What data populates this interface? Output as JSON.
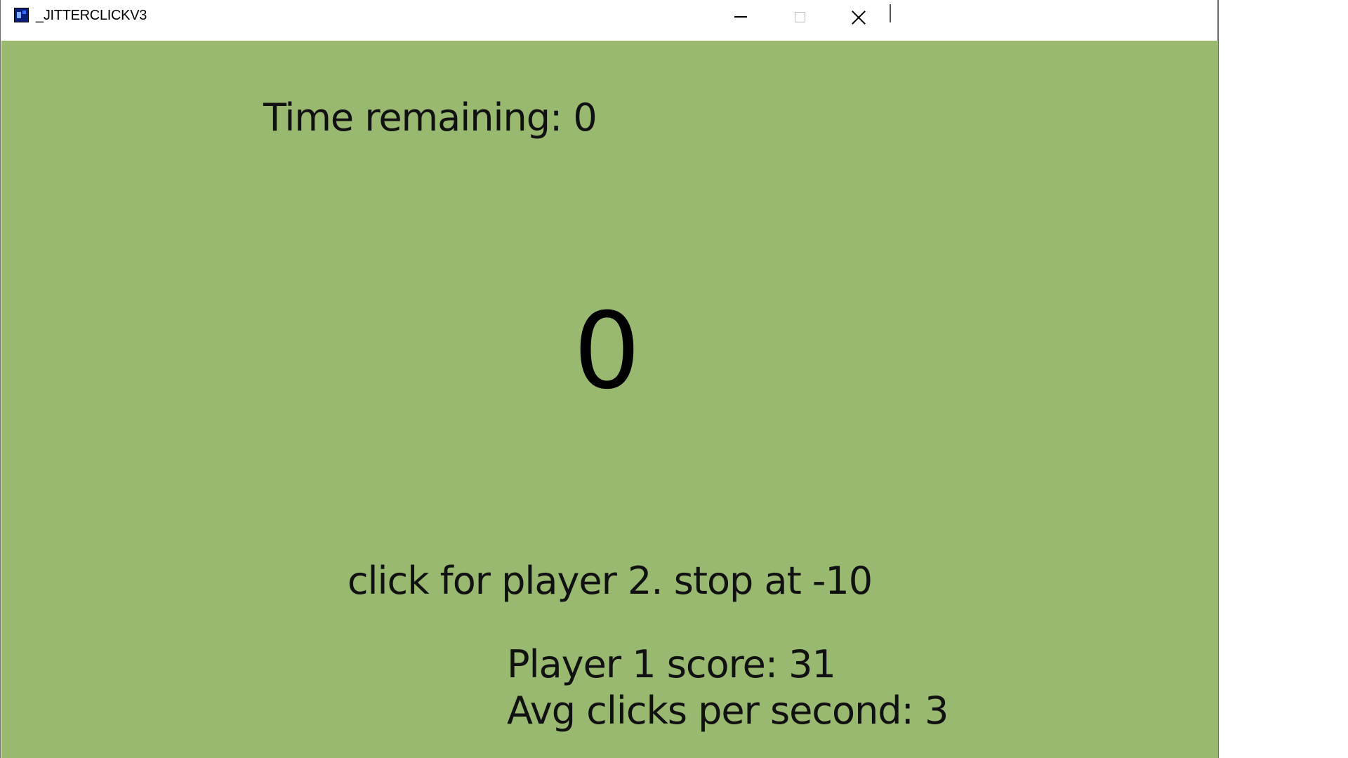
{
  "window": {
    "title": "_JITTERCLICKV3"
  },
  "game": {
    "time_remaining": "Time remaining: 0",
    "counter": "0",
    "instruction": "click for player 2. stop at -10",
    "player1_score": "Player 1 score: 31",
    "avg_clicks": "Avg clicks per second: 3"
  },
  "colors": {
    "game_background": "#98b96f",
    "text": "#111111"
  },
  "icons": {
    "app": "app-icon",
    "minimize": "minimize-icon",
    "maximize": "maximize-icon",
    "close": "close-icon"
  }
}
